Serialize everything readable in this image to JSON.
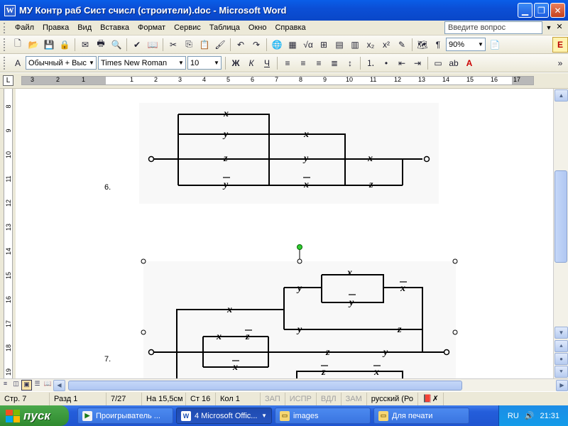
{
  "window": {
    "title": "МУ Контр раб Сист счисл (строители).doc - Microsoft Word",
    "min_icon": "minimize-icon",
    "max_icon": "maximize-icon",
    "close_icon": "close-icon"
  },
  "menu": {
    "items": [
      "Файл",
      "Правка",
      "Вид",
      "Вставка",
      "Формат",
      "Сервис",
      "Таблица",
      "Окно",
      "Справка"
    ],
    "ask_placeholder": "Введите вопрос"
  },
  "toolbar": {
    "zoom": "90%",
    "style": "Обычный + Выс",
    "font": "Times New Roman",
    "size": "10"
  },
  "ruler": {
    "h_labels": [
      "3",
      "2",
      "1",
      "1",
      "2",
      "3",
      "4",
      "5",
      "6",
      "7",
      "8",
      "9",
      "10",
      "11",
      "12",
      "13",
      "14",
      "15",
      "16",
      "17"
    ],
    "v_labels": [
      "8",
      "9",
      "10",
      "11",
      "12",
      "13",
      "14",
      "15",
      "16",
      "17",
      "18",
      "19"
    ]
  },
  "document": {
    "item6": "6.",
    "item7": "7.",
    "c6": {
      "top": "x",
      "mid1": "y",
      "mid2": "z",
      "bot": "y",
      "m_top": "x",
      "m_mid": "y",
      "m_bot": "x",
      "r_top": "x",
      "r_bot": "z"
    },
    "c7": {
      "a_top": "x",
      "a_bot": "y",
      "b_top": "y",
      "b_mid": "x",
      "c_top": "x",
      "c_main": "y",
      "c_main2": "z",
      "d_x": "x",
      "d_z": "z",
      "d_xbar": "x",
      "e_z": "z",
      "e_y": "y",
      "f_z": "z",
      "f_x": "x"
    }
  },
  "status": {
    "page": "Стр. 7",
    "section": "Разд 1",
    "pages": "7/27",
    "at": "На 15,5см",
    "line": "Ст 16",
    "col": "Кол 1",
    "rec": "ЗАП",
    "trk": "ИСПР",
    "ext": "ВДЛ",
    "ovr": "ЗАМ",
    "lang": "русский (Ро"
  },
  "taskbar": {
    "start": "пуск",
    "tasks": [
      "Проигрыватель ...",
      "4 Microsoft Offic...",
      "images",
      "Для печати"
    ],
    "lang": "RU",
    "clock": "21:31"
  }
}
